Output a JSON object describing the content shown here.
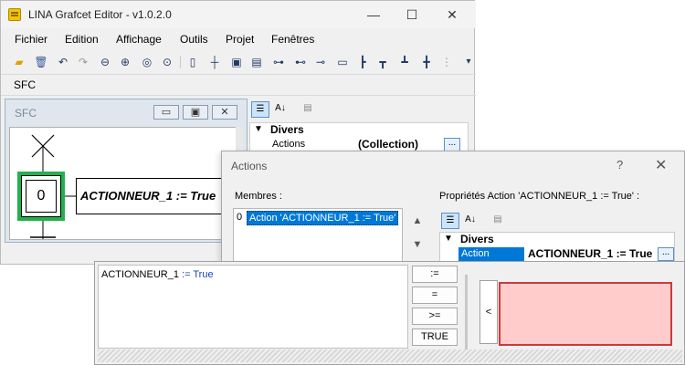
{
  "app": {
    "title": "LINA Grafcet Editor - v1.0.2.0",
    "controls": {
      "minimize": "—",
      "maximize": "☐",
      "close": "✕"
    }
  },
  "menu": {
    "items": [
      "Fichier",
      "Edition",
      "Affichage",
      "Outils",
      "Projet",
      "Fenêtres"
    ]
  },
  "toolbar": {
    "icons": [
      "open-folder-icon",
      "delete-icon",
      "undo-icon",
      "redo-icon",
      "zoom-out-icon",
      "zoom-in-icon",
      "zoom-fit-icon",
      "zoom-reset-icon",
      "step-icon",
      "transition-icon",
      "initial-step-icon",
      "macro-step-icon",
      "action-icon",
      "comment-icon",
      "link-icon",
      "divergence-or-icon",
      "convergence-or-icon",
      "divergence-and-icon",
      "convergence-and-icon",
      "jump-icon"
    ],
    "overflow": "▾"
  },
  "sfc_tab": {
    "label": "SFC"
  },
  "sfc_window": {
    "title": "SFC",
    "buttons": {
      "minimize": "▭",
      "restore": "▣",
      "close": "✕"
    },
    "step_number": "0",
    "action_text": "ACTIONNEUR_1 := True",
    "colors": {
      "highlight": "#22b14c"
    }
  },
  "property_panel": {
    "category": "Divers",
    "row_label": "Actions",
    "row_value": "(Collection)",
    "ellipsis": "..."
  },
  "actions_dialog": {
    "title": "Actions",
    "help": "?",
    "close": "✕",
    "members_label": "Membres :",
    "member_index": "0",
    "member_item": "Action 'ACTIONNEUR_1 := True'",
    "up_arrow": "▲",
    "down_arrow": "▼",
    "props_label": "Propriétés Action 'ACTIONNEUR_1 := True' :",
    "category": "Divers",
    "row_label": "Action",
    "row_value": "ACTIONNEUR_1 := True",
    "ellipsis": "..."
  },
  "editor": {
    "code_var": "ACTIONNEUR_1",
    "code_op": " := ",
    "code_val": "True",
    "buttons": [
      ":=",
      "=",
      ">=",
      "TRUE"
    ],
    "collapse": "<",
    "colors": {
      "error_fill": "#ffcccb",
      "error_border": "#cc3a3a",
      "keyword": "#2040c0"
    }
  }
}
